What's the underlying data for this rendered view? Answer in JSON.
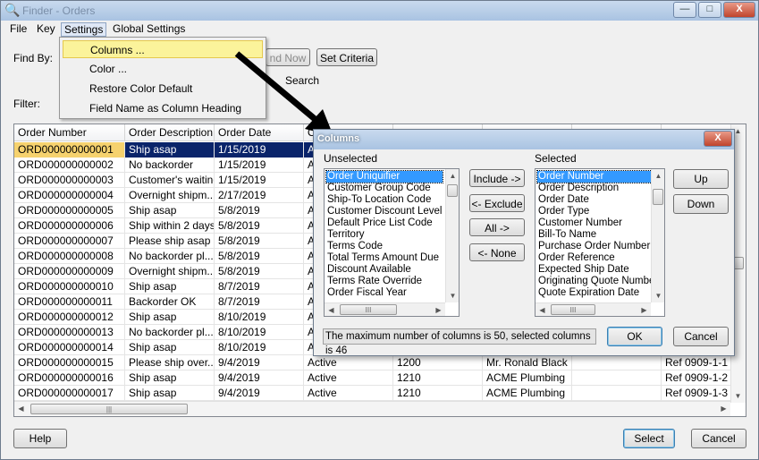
{
  "window": {
    "title": "Finder - Orders",
    "min": "—",
    "max": "□",
    "close": "X"
  },
  "menubar": [
    "File",
    "Key",
    "Settings",
    "Global Settings"
  ],
  "settings_menu": [
    "Columns ...",
    "Color ...",
    "Restore Color Default",
    "Field Name as Column Heading"
  ],
  "find_by_label": "Find By:",
  "filter_label": "Filter:",
  "find_now_button": "nd Now",
  "set_criteria_button": "Set Criteria",
  "search_label": "Search",
  "grid": {
    "headers": [
      "Order Number",
      "Order Description",
      "Order Date",
      "O"
    ],
    "rows": [
      [
        "ORD000000000001",
        "Ship asap",
        "1/15/2019",
        "A"
      ],
      [
        "ORD000000000002",
        "No backorder",
        "1/15/2019",
        "A"
      ],
      [
        "ORD000000000003",
        "Customer's waiting",
        "1/15/2019",
        "A"
      ],
      [
        "ORD000000000004",
        "Overnight shipm...",
        "2/17/2019",
        "A"
      ],
      [
        "ORD000000000005",
        "Ship asap",
        "5/8/2019",
        "A"
      ],
      [
        "ORD000000000006",
        "Ship within 2 days",
        "5/8/2019",
        "A"
      ],
      [
        "ORD000000000007",
        "Please ship asap",
        "5/8/2019",
        "A"
      ],
      [
        "ORD000000000008",
        "No backorder pl...",
        "5/8/2019",
        "A"
      ],
      [
        "ORD000000000009",
        "Overnight shipm...",
        "5/8/2019",
        "A"
      ],
      [
        "ORD000000000010",
        "Ship asap",
        "8/7/2019",
        "A"
      ],
      [
        "ORD000000000011",
        "Backorder OK",
        "8/7/2019",
        "A"
      ],
      [
        "ORD000000000012",
        "Ship asap",
        "8/10/2019",
        "A"
      ],
      [
        "ORD000000000013",
        "No backorder pl...",
        "8/10/2019",
        "A"
      ],
      [
        "ORD000000000014",
        "Ship asap",
        "8/10/2019",
        "A"
      ]
    ],
    "full_rows": [
      [
        "ORD000000000015",
        "Please ship over...",
        "9/4/2019",
        "Active",
        "1200",
        "Mr. Ronald Black",
        "",
        "Ref 0909-1-1"
      ],
      [
        "ORD000000000016",
        "Ship asap",
        "9/4/2019",
        "Active",
        "1210",
        "ACME Plumbing",
        "",
        "Ref 0909-1-2"
      ],
      [
        "ORD000000000017",
        "Ship asap",
        "9/4/2019",
        "Active",
        "1210",
        "ACME Plumbing",
        "",
        "Ref 0909-1-3"
      ]
    ],
    "scroll_thumb": "|||"
  },
  "columns_dialog": {
    "title": "Columns",
    "close": "X",
    "unselected_label": "Unselected",
    "selected_label": "Selected",
    "unselected": [
      "Order Uniquifier",
      "Customer Group Code",
      "Ship-To Location Code",
      "Customer Discount Level",
      "Default Price List Code",
      "Territory",
      "Terms Code",
      "Total Terms Amount Due",
      "Discount Available",
      "Terms Rate Override",
      "Order Fiscal Year"
    ],
    "selected": [
      "Order Number",
      "Order Description",
      "Order Date",
      "Order Type",
      "Customer Number",
      "Bill-To Name",
      "Purchase Order Number",
      "Order Reference",
      "Expected Ship Date",
      "Originating Quote Number",
      "Quote Expiration Date"
    ],
    "include_button": "Include ->",
    "exclude_button": "<- Exclude",
    "all_button": "All ->",
    "none_button": "<- None",
    "up_button": "Up",
    "down_button": "Down",
    "status": "The maximum number of columns is 50, selected columns is 46",
    "ok_button": "OK",
    "cancel_button": "Cancel",
    "scroll_thumb": "III"
  },
  "footer": {
    "help": "Help",
    "select": "Select",
    "cancel": "Cancel"
  },
  "colors": {
    "highlight_menu": "#fbf39b",
    "selected_row": "#0a246a",
    "selected_cell": "#f6d26e",
    "list_selection": "#3399ff"
  }
}
